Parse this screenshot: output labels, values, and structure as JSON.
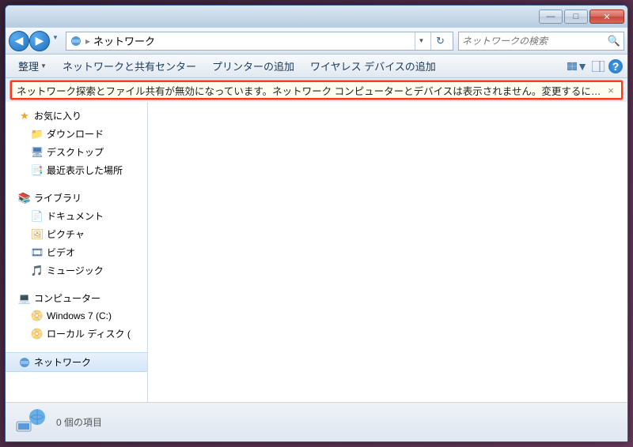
{
  "titlebar": {
    "min_glyph": "—",
    "max_glyph": "□",
    "close_glyph": "✕"
  },
  "nav": {
    "back_glyph": "◀",
    "fwd_glyph": "▶",
    "crumb": "ネットワーク",
    "refresh_glyph": "↻",
    "search_placeholder": "ネットワークの検索",
    "search_glyph": "🔍"
  },
  "toolbar": {
    "organize": "整理",
    "network_center": "ネットワークと共有センター",
    "add_printer": "プリンターの追加",
    "add_wireless": "ワイヤレス デバイスの追加",
    "help_glyph": "?"
  },
  "info_bar": {
    "text": "ネットワーク探索とファイル共有が無効になっています。ネットワーク コンピューターとデバイスは表示されません。変更するにはクリックして...",
    "close_glyph": "×"
  },
  "sidebar": {
    "favorites": {
      "label": "お気に入り",
      "items": [
        {
          "label": "ダウンロード",
          "icon": "📁",
          "cls": "ico-folder",
          "name": "tree-downloads"
        },
        {
          "label": "デスクトップ",
          "icon": "🖥",
          "cls": "ico-desktop",
          "name": "tree-desktop"
        },
        {
          "label": "最近表示した場所",
          "icon": "📑",
          "cls": "ico-recent",
          "name": "tree-recent"
        }
      ]
    },
    "libraries": {
      "label": "ライブラリ",
      "items": [
        {
          "label": "ドキュメント",
          "icon": "📄",
          "cls": "ico-doc",
          "name": "tree-documents"
        },
        {
          "label": "ピクチャ",
          "icon": "🖼",
          "cls": "ico-pic",
          "name": "tree-pictures"
        },
        {
          "label": "ビデオ",
          "icon": "🎞",
          "cls": "ico-vid",
          "name": "tree-videos"
        },
        {
          "label": "ミュージック",
          "icon": "🎵",
          "cls": "ico-mus",
          "name": "tree-music"
        }
      ]
    },
    "computer": {
      "label": "コンピューター",
      "items": [
        {
          "label": "Windows 7 (C:)",
          "icon": "📀",
          "cls": "ico-drive",
          "name": "tree-drive-c"
        },
        {
          "label": "ローカル ディスク (",
          "icon": "📀",
          "cls": "ico-drive",
          "name": "tree-drive-local"
        }
      ]
    },
    "network": {
      "label": "ネットワーク"
    }
  },
  "status": {
    "count_text": "0 個の項目"
  }
}
